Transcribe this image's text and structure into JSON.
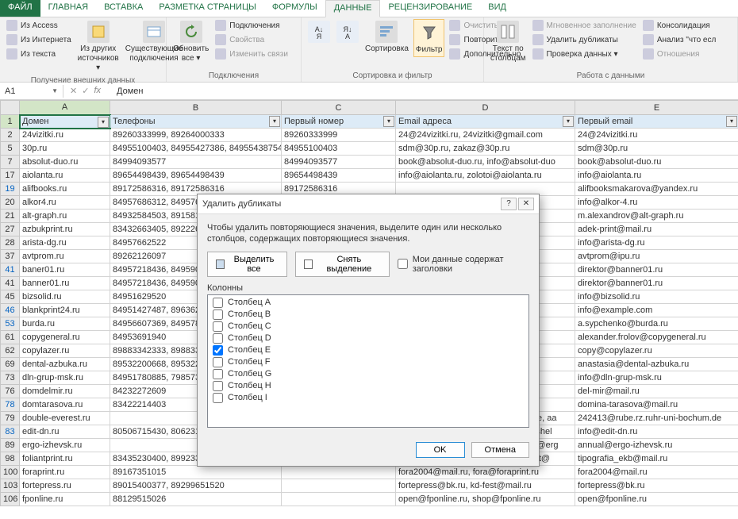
{
  "ribbon": {
    "tabs": [
      "ФАЙЛ",
      "ГЛАВНАЯ",
      "ВСТАВКА",
      "РАЗМЕТКА СТРАНИЦЫ",
      "ФОРМУЛЫ",
      "ДАННЫЕ",
      "РЕЦЕНЗИРОВАНИЕ",
      "ВИД"
    ],
    "active_tab": "ДАННЫЕ",
    "groups": {
      "ext_data": {
        "label": "Получение внешних данных",
        "items": [
          "Из Access",
          "Из Интернета",
          "Из текста"
        ],
        "btn1": "Из других\nисточников ▾",
        "btn2": "Существующие\nподключения"
      },
      "connections": {
        "label": "Подключения",
        "refresh": "Обновить\nвсе ▾",
        "items": [
          "Подключения",
          "Свойства",
          "Изменить связи"
        ]
      },
      "sortfilter": {
        "label": "Сортировка и фильтр",
        "sort": "Сортировка",
        "filter": "Фильтр",
        "items": [
          "Очистить",
          "Повторить",
          "Дополнительно"
        ]
      },
      "datatools": {
        "label": "Работа с данными",
        "texttocol": "Текст по\nстолбцам",
        "items": [
          "Мгновенное заполнение",
          "Удалить дубликаты",
          "Проверка данных ▾"
        ],
        "items2": [
          "Консолидация",
          "Анализ \"что есл",
          "Отношения"
        ]
      }
    }
  },
  "formula_bar": {
    "namebox": "A1",
    "value": "Домен"
  },
  "columns": [
    "A",
    "B",
    "C",
    "D",
    "E"
  ],
  "headers": [
    "Домен",
    "Телефоны",
    "Первый номер",
    "Email адреса",
    "Первый email"
  ],
  "rows": [
    {
      "n": "1",
      "hdr": true
    },
    {
      "n": "2",
      "c": [
        "24vizitki.ru",
        "89260333999, 89264000333",
        "89260333999",
        "24@24vizitki.ru, 24vizitki@gmail.com",
        "24@24vizitki.ru"
      ]
    },
    {
      "n": "5",
      "c": [
        "30p.ru",
        "84955100403, 84955427386, 84955438754,",
        "84955100403",
        "sdm@30p.ru, zakaz@30p.ru",
        "sdm@30p.ru"
      ]
    },
    {
      "n": "7",
      "c": [
        "absolut-duo.ru",
        "84994093577",
        "84994093577",
        "book@absolut-duo.ru, info@absolut-duo",
        "book@absolut-duo.ru"
      ]
    },
    {
      "n": "17",
      "c": [
        "aiolanta.ru",
        "89654498439, 89654498439",
        "89654498439",
        "info@aiolanta.ru, zolotoi@aiolanta.ru",
        "info@aiolanta.ru"
      ]
    },
    {
      "n": "19",
      "c": [
        "alifbooks.ru",
        "89172586316, 89172586316",
        "89172586316",
        "",
        "alifbooksmakarova@yandex.ru"
      ],
      "b": true
    },
    {
      "n": "20",
      "c": [
        "alkor4.ru",
        "84957686312, 84957686312",
        "",
        "",
        "info@alkor-4.ru"
      ]
    },
    {
      "n": "21",
      "c": [
        "alt-graph.ru",
        "84932584503, 89158184503",
        "",
        "",
        "m.alexandrov@alt-graph.ru"
      ]
    },
    {
      "n": "27",
      "c": [
        "azbukprint.ru",
        "83432663405, 89222663405",
        "",
        "",
        "adek-print@mail.ru"
      ]
    },
    {
      "n": "28",
      "c": [
        "arista-dg.ru",
        "84957662522",
        "",
        "",
        "info@arista-dg.ru"
      ]
    },
    {
      "n": "37",
      "c": [
        "avtprom.ru",
        "89262126097",
        "",
        "",
        "avtprom@ipu.ru"
      ]
    },
    {
      "n": "41",
      "c": [
        "baner01.ru",
        "84957218436, 84959060503",
        "",
        "",
        "direktor@banner01.ru"
      ],
      "b": true
    },
    {
      "n": "41",
      "c": [
        "banner01.ru",
        "84957218436, 84959060503",
        "",
        "",
        "direktor@banner01.ru"
      ]
    },
    {
      "n": "45",
      "c": [
        "bizsolid.ru",
        "84951629520",
        "",
        "",
        "info@bizsolid.ru"
      ]
    },
    {
      "n": "46",
      "c": [
        "blankprint24.ru",
        "84951427487, 89636205458",
        "",
        "",
        "info@example.com"
      ],
      "b": true
    },
    {
      "n": "53",
      "c": [
        "burda.ru",
        "84956607369, 84957871722",
        "",
        "",
        "a.sypchenko@burda.ru"
      ],
      "b": true
    },
    {
      "n": "61",
      "c": [
        "copygeneral.ru",
        "84953691940",
        "",
        "",
        "alexander.frolov@copygeneral.ru"
      ]
    },
    {
      "n": "62",
      "c": [
        "copylazer.ru",
        "89883342333, 89883342333",
        "",
        "",
        "copy@copylazer.ru"
      ]
    },
    {
      "n": "69",
      "c": [
        "dental-azbuka.ru",
        "89532200668, 89532200668",
        "",
        "",
        "anastasia@dental-azbuka.ru"
      ]
    },
    {
      "n": "73",
      "c": [
        "dln-grup-msk.ru",
        "84951780885, 79857382422",
        "",
        "",
        "info@dln-grup-msk.ru"
      ]
    },
    {
      "n": "76",
      "c": [
        "domdelmir.ru",
        "84232272609",
        "",
        "",
        "del-mir@mail.ru"
      ]
    },
    {
      "n": "78",
      "c": [
        "domtarasova.ru",
        "83422214403",
        "",
        "",
        "domina-tarasova@mail.ru"
      ],
      "b": true
    },
    {
      "n": "79",
      "c": [
        "double-everest.ru",
        "",
        "",
        "242413@rube.rz.ruhr-uni-bochum.de, aa",
        "242413@rube.rz.ruhr-uni-bochum.de"
      ]
    },
    {
      "n": "83",
      "c": [
        "edit-dn.ru",
        "80506715430, 80623130104, 80623130455, 80713323675, 80953829884",
        "",
        "info@edit-dn.ru, nushok2@mail.ru, shel",
        "info@edit-dn.ru"
      ],
      "b": true
    },
    {
      "n": "89",
      "c": [
        "ergo-izhevsk.ru",
        "",
        "",
        "annual@ergo-izhevsk.ru, anthropos@erg",
        "annual@ergo-izhevsk.ru"
      ]
    },
    {
      "n": "98",
      "c": [
        "foliantprint.ru",
        "83435230400, 89923337010",
        "",
        "tipografia_ekb@mail.ru, tipografia_nt@",
        "tipografia_ekb@mail.ru"
      ]
    },
    {
      "n": "100",
      "c": [
        "foraprint.ru",
        "89167351015",
        "",
        "fora2004@mail.ru, fora@foraprint.ru",
        "fora2004@mail.ru"
      ]
    },
    {
      "n": "103",
      "c": [
        "fortepress.ru",
        "89015400377, 89299651520",
        "",
        "fortepress@bk.ru, kd-fest@mail.ru",
        "fortepress@bk.ru"
      ]
    },
    {
      "n": "106",
      "c": [
        "fponline.ru",
        "88129515026",
        "",
        "open@fponline.ru, shop@fponline.ru",
        "open@fponline.ru"
      ]
    }
  ],
  "dialog": {
    "title": "Удалить дубликаты",
    "desc": "Чтобы удалить повторяющиеся значения, выделите один или несколько столбцов, содержащих повторяющиеся значения.",
    "select_all": "Выделить все",
    "deselect_all": "Снять выделение",
    "has_headers": "Мои данные содержат заголовки",
    "columns_label": "Колонны",
    "columns": [
      {
        "label": "Столбец A",
        "checked": false
      },
      {
        "label": "Столбец B",
        "checked": false
      },
      {
        "label": "Столбец C",
        "checked": false
      },
      {
        "label": "Столбец D",
        "checked": false
      },
      {
        "label": "Столбец E",
        "checked": true
      },
      {
        "label": "Столбец F",
        "checked": false
      },
      {
        "label": "Столбец G",
        "checked": false
      },
      {
        "label": "Столбец H",
        "checked": false
      },
      {
        "label": "Столбец I",
        "checked": false
      }
    ],
    "ok": "OK",
    "cancel": "Отмена"
  }
}
